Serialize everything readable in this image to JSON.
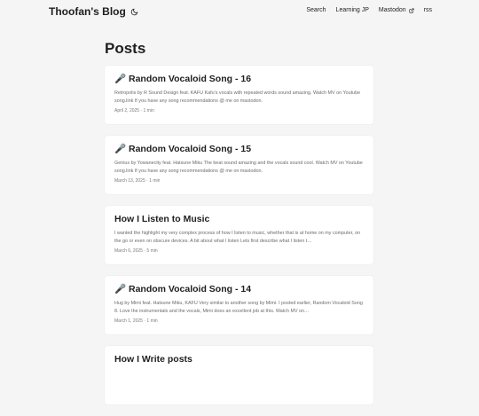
{
  "header": {
    "site_title": "Thoofan's Blog",
    "theme_icon": "moon-icon",
    "nav": [
      {
        "label": "Search"
      },
      {
        "label": "Learning JP"
      },
      {
        "label": "Mastodon",
        "icon": "external-link-icon"
      },
      {
        "label": "rss"
      }
    ]
  },
  "main": {
    "page_title": "Posts",
    "posts": [
      {
        "title": "🎤 Random Vocaloid Song - 16",
        "excerpt": "Retropolis by R Sound Design feat. KAFU Kafu's vocals with repeated words sound amazing. Watch MV on Youtube song.link If you have any song recommendations @ me on mastodon.",
        "meta": "April 2, 2025 · 1 min"
      },
      {
        "title": "🎤 Random Vocaloid Song - 15",
        "excerpt": "Genius by Yowanecity feat. Hatsune Miku The beat sound amazing and the vocals sound cool. Watch MV on Youtube song.link If you have any song recommendations @ me on mastodon.",
        "meta": "March 13, 2025 · 1 min"
      },
      {
        "title": "How I Listen to Music",
        "excerpt": "I wanted the highlight my very complex process of how I listen to music, whether that is at home on my computer, on the go or even on obscure devices. A bit about what I listen Lets first describe what I listen t…",
        "meta": "March 6, 2025 · 5 min"
      },
      {
        "title": "🎤 Random Vocaloid Song - 14",
        "excerpt": "Hug by Mimi feat. Hatsune Miku, KAFU Very similar to another song by Mimi. I posted earlier, Random Vocaloid Song 8. Love the instrumentals and the vocals, Mimi does an excellent job at this. Watch MV on…",
        "meta": "March 1, 2025 · 1 min"
      },
      {
        "title": "How I Write posts",
        "excerpt": "",
        "meta": ""
      }
    ]
  }
}
